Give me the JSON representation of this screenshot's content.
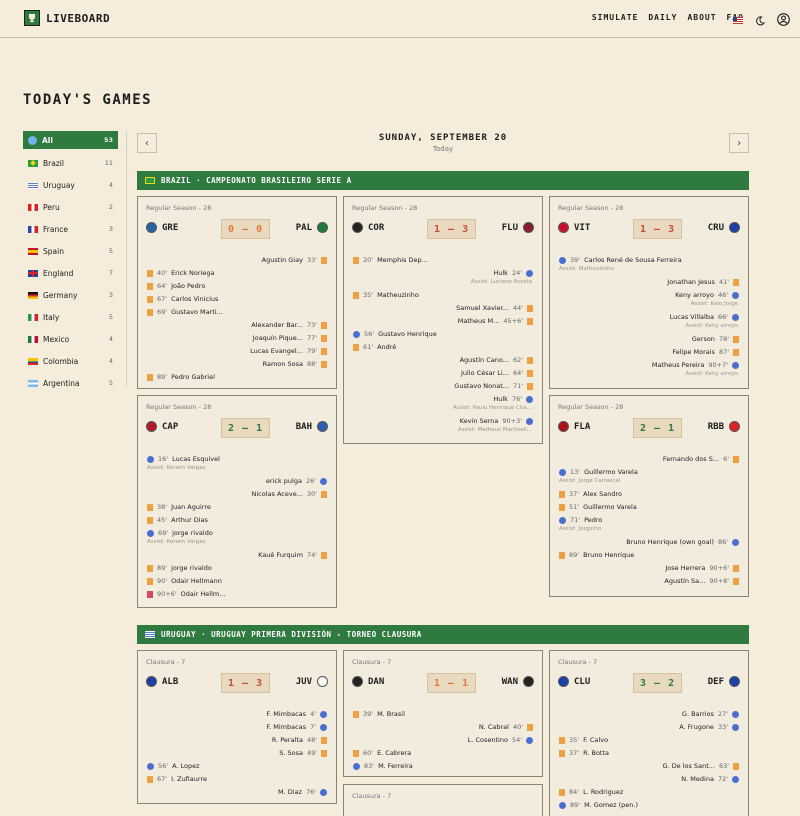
{
  "brand": "LIVEBOARD",
  "nav": [
    "SIMULATE",
    "DAILY",
    "ABOUT",
    "FAQ"
  ],
  "page_title": "TODAY'S GAMES",
  "sidebar": [
    {
      "label": "All",
      "count": "53"
    },
    {
      "label": "Brazil",
      "count": "11"
    },
    {
      "label": "Uruguay",
      "count": "4"
    },
    {
      "label": "Peru",
      "count": "2"
    },
    {
      "label": "France",
      "count": "3"
    },
    {
      "label": "Spain",
      "count": "5"
    },
    {
      "label": "England",
      "count": "7"
    },
    {
      "label": "Germany",
      "count": "3"
    },
    {
      "label": "Italy",
      "count": "5"
    },
    {
      "label": "Mexico",
      "count": "4"
    },
    {
      "label": "Colombia",
      "count": "4"
    },
    {
      "label": "Argentina",
      "count": "5"
    }
  ],
  "date": {
    "title": "SUNDAY, SEPTEMBER 20",
    "sub": "Today",
    "prev": "‹",
    "next": "›"
  },
  "leagues": [
    {
      "label": "BRAZIL · CAMPEONATO BRASILEIRO SERIE A"
    },
    {
      "label": "URUGUAY · URUGUAY PRIMERA DIVISIÓN - TORNEO CLAUSURA"
    }
  ],
  "games": {
    "g1": {
      "stage": "Regular Season - 28",
      "home": "GRE",
      "away": "PAL",
      "score": "0 – 0",
      "events": [
        {
          "side": "r",
          "text": "Agustin Giay",
          "min": "33'",
          "icon": "yc"
        },
        {
          "side": "l",
          "text": "Erick Noriega",
          "min": "40'",
          "icon": "yc"
        },
        {
          "side": "l",
          "text": "João Pedro",
          "min": "64'",
          "icon": "yc"
        },
        {
          "side": "l",
          "text": "Carlos Vinicius",
          "min": "67'",
          "icon": "yc"
        },
        {
          "side": "l",
          "text": "Gustavo Marti...",
          "min": "69'",
          "icon": "yc"
        },
        {
          "side": "r",
          "text": "Alexander Bar...",
          "min": "73'",
          "icon": "yc"
        },
        {
          "side": "r",
          "text": "Joaquín Pique...",
          "min": "77'",
          "icon": "yc"
        },
        {
          "side": "r",
          "text": "Lucas Evangel...",
          "min": "79'",
          "icon": "yc"
        },
        {
          "side": "r",
          "text": "Ramon Sosa",
          "min": "88'",
          "icon": "yc"
        },
        {
          "side": "l",
          "text": "Pedro Gabriel",
          "min": "89'",
          "icon": "yc"
        }
      ]
    },
    "g2": {
      "stage": "Regular Season - 28",
      "home": "COR",
      "away": "FLU",
      "score": "1 – 3",
      "events": [
        {
          "side": "l",
          "text": "Memphis Dep...",
          "min": "20'",
          "icon": "yc"
        },
        {
          "side": "r",
          "text": "Hulk",
          "min": "24'",
          "icon": "ball"
        },
        {
          "side": "r",
          "text": "Assist: Luciano Acosta",
          "assist": true
        },
        {
          "side": "l",
          "text": "Matheuzinho",
          "min": "35'",
          "icon": "yc"
        },
        {
          "side": "r",
          "text": "Samuel Xavier...",
          "min": "44'",
          "icon": "yc"
        },
        {
          "side": "r",
          "text": "Matheus M...",
          "min": "45+6'",
          "icon": "yc"
        },
        {
          "side": "l",
          "text": "Gustavo Henrique",
          "min": "56'",
          "icon": "ball"
        },
        {
          "side": "l",
          "text": "André",
          "min": "61'",
          "icon": "yc"
        },
        {
          "side": "r",
          "text": "Agustín Cano...",
          "min": "62'",
          "icon": "yc"
        },
        {
          "side": "r",
          "text": "Julio César Li...",
          "min": "64'",
          "icon": "yc"
        },
        {
          "side": "r",
          "text": "Gustavo Nonat...",
          "min": "71'",
          "icon": "yc"
        },
        {
          "side": "r",
          "text": "Hulk",
          "min": "76'",
          "icon": "ball"
        },
        {
          "side": "r",
          "text": "Assist: Paulo Henrique Cha...",
          "assist": true
        },
        {
          "side": "r",
          "text": "Kevin Serna",
          "min": "90+3'",
          "icon": "ball"
        },
        {
          "side": "r",
          "text": "Assist: Matheus Martinell...",
          "assist": true
        }
      ]
    },
    "g3": {
      "stage": "Regular Season - 28",
      "home": "VIT",
      "away": "CRU",
      "score": "1 – 3",
      "events": [
        {
          "side": "l",
          "text": "Carlos René de Sousa Ferreira",
          "min": "39'",
          "icon": "ball"
        },
        {
          "side": "l",
          "text": "Assist: Matheuzinho",
          "assist": true
        },
        {
          "side": "r",
          "text": "Jonathan Jesus",
          "min": "41'",
          "icon": "yc"
        },
        {
          "side": "r",
          "text": "Keny arroyo",
          "min": "46'",
          "icon": "ball"
        },
        {
          "side": "r",
          "text": "Assist: Kaio Jorge",
          "assist": true
        },
        {
          "side": "r",
          "text": "Lucas Villalba",
          "min": "66'",
          "icon": "ball"
        },
        {
          "side": "r",
          "text": "Assist: Keny arroyo",
          "assist": true
        },
        {
          "side": "r",
          "text": "Gerson",
          "min": "78'",
          "icon": "yc"
        },
        {
          "side": "r",
          "text": "Felipe Morais",
          "min": "87'",
          "icon": "yc"
        },
        {
          "side": "r",
          "text": "Matheus Pereira",
          "min": "90+7'",
          "icon": "ball"
        },
        {
          "side": "r",
          "text": "Assist: Keny arroyo",
          "assist": true
        }
      ]
    },
    "g4": {
      "stage": "Regular Season - 28",
      "home": "CAP",
      "away": "BAH",
      "score": "2 – 1",
      "events": [
        {
          "side": "l",
          "text": "Lucas Esquivel",
          "min": "16'",
          "icon": "ball"
        },
        {
          "side": "l",
          "text": "Assist: Kerwin Vargas",
          "assist": true
        },
        {
          "side": "r",
          "text": "erick pulga",
          "min": "26'",
          "icon": "ball"
        },
        {
          "side": "r",
          "text": "Nicolas Aceve...",
          "min": "30'",
          "icon": "yc"
        },
        {
          "side": "l",
          "text": "Juan Aguirre",
          "min": "38'",
          "icon": "yc"
        },
        {
          "side": "l",
          "text": "Arthur Dias",
          "min": "45'",
          "icon": "yc"
        },
        {
          "side": "l",
          "text": "jorge rivaldo",
          "min": "69'",
          "icon": "ball"
        },
        {
          "side": "l",
          "text": "Assist: Kerwin Vargas",
          "assist": true
        },
        {
          "side": "r",
          "text": "Kauê Furquim",
          "min": "74'",
          "icon": "yc"
        },
        {
          "side": "l",
          "text": "jorge rivaldo",
          "min": "89'",
          "icon": "yc"
        },
        {
          "side": "l",
          "text": "Odair Hellmann",
          "min": "90'",
          "icon": "yc"
        },
        {
          "side": "l",
          "text": "Odair Hellm...",
          "min": "90+6'",
          "icon": "rc"
        }
      ]
    },
    "g5": {
      "stage": "Regular Season - 28",
      "home": "FLA",
      "away": "RBB",
      "score": "2 – 1",
      "events": [
        {
          "side": "r",
          "text": "Fernando dos S...",
          "min": "6'",
          "icon": "yc"
        },
        {
          "side": "l",
          "text": "Guillermo Varela",
          "min": "13'",
          "icon": "ball"
        },
        {
          "side": "l",
          "text": "Assist: Jorge Carrascal",
          "assist": true
        },
        {
          "side": "l",
          "text": "Alex Sandro",
          "min": "37'",
          "icon": "yc"
        },
        {
          "side": "l",
          "text": "Guillermo Varela",
          "min": "51'",
          "icon": "yc"
        },
        {
          "side": "l",
          "text": "Pedro",
          "min": "71'",
          "icon": "ball"
        },
        {
          "side": "l",
          "text": "Assist: Jorginho",
          "assist": true
        },
        {
          "side": "r",
          "text": "Bruno Henrique (own goal)",
          "min": "86'",
          "icon": "ball"
        },
        {
          "side": "l",
          "text": "Bruno Henrique",
          "min": "89'",
          "icon": "yc"
        },
        {
          "side": "r",
          "text": "Jose Herrera",
          "min": "90+6'",
          "icon": "yc"
        },
        {
          "side": "r",
          "text": "Agustín Sa...",
          "min": "90+8'",
          "icon": "yc"
        }
      ]
    },
    "u1": {
      "stage": "Clausura - 7",
      "home": "ALB",
      "away": "JUV",
      "score": "1 – 3",
      "events": [
        {
          "side": "r",
          "text": "F. Mimbacas",
          "min": "4'",
          "icon": "ball"
        },
        {
          "side": "r",
          "text": "F. Mimbacas",
          "min": "7'",
          "icon": "ball"
        },
        {
          "side": "r",
          "text": "R. Peralta",
          "min": "48'",
          "icon": "yc"
        },
        {
          "side": "r",
          "text": "S. Sosa",
          "min": "49'",
          "icon": "yc"
        },
        {
          "side": "l",
          "text": "A. Lopez",
          "min": "56'",
          "icon": "ball"
        },
        {
          "side": "l",
          "text": "I. Zufiaurre",
          "min": "67'",
          "icon": "yc"
        },
        {
          "side": "r",
          "text": "M. Diaz",
          "min": "76'",
          "icon": "ball"
        }
      ]
    },
    "u2": {
      "stage": "Clausura - 7",
      "home": "DAN",
      "away": "WAN",
      "score": "1 – 1",
      "events": [
        {
          "side": "l",
          "text": "M. Brasil",
          "min": "39'",
          "icon": "yc"
        },
        {
          "side": "r",
          "text": "N. Cabral",
          "min": "40'",
          "icon": "yc"
        },
        {
          "side": "r",
          "text": "L. Cosentino",
          "min": "54'",
          "icon": "ball"
        },
        {
          "side": "l",
          "text": "E. Cabrera",
          "min": "60'",
          "icon": "yc"
        },
        {
          "side": "l",
          "text": "M. Ferreira",
          "min": "83'",
          "icon": "ball"
        }
      ]
    },
    "u3": {
      "stage": "Clausura - 7",
      "home": "CLU",
      "away": "DEF",
      "score": "3 – 2",
      "events": [
        {
          "side": "r",
          "text": "G. Barrios",
          "min": "27'",
          "icon": "ball"
        },
        {
          "side": "r",
          "text": "A. Frugone",
          "min": "33'",
          "icon": "ball"
        },
        {
          "side": "l",
          "text": "F. Calvo",
          "min": "35'",
          "icon": "yc"
        },
        {
          "side": "l",
          "text": "R. Botta",
          "min": "37'",
          "icon": "yc"
        },
        {
          "side": "r",
          "text": "G. De los Sant...",
          "min": "63'",
          "icon": "yc"
        },
        {
          "side": "r",
          "text": "N. Medina",
          "min": "72'",
          "icon": "ball"
        },
        {
          "side": "l",
          "text": "L. Rodriguez",
          "min": "84'",
          "icon": "yc"
        },
        {
          "side": "l",
          "text": "M. Gomez (pen.)",
          "min": "89'",
          "icon": "ball"
        }
      ]
    },
    "u4": {
      "stage": "Clausura - 7"
    }
  }
}
